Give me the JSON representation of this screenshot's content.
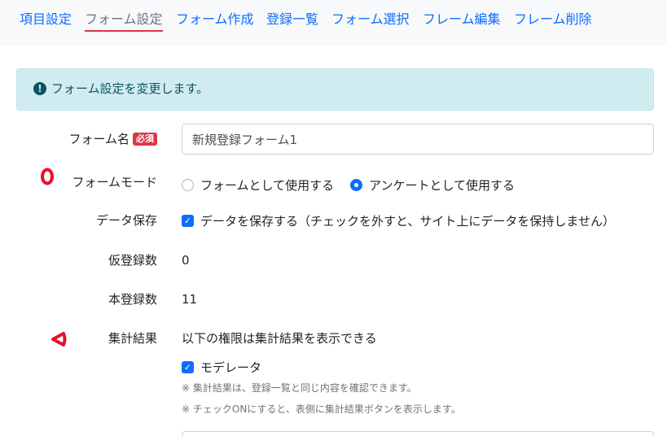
{
  "nav": {
    "tabs": [
      {
        "label": "項目設定"
      },
      {
        "label": "フォーム設定"
      },
      {
        "label": "フォーム作成"
      },
      {
        "label": "登録一覧"
      },
      {
        "label": "フォーム選択"
      },
      {
        "label": "フレーム編集"
      },
      {
        "label": "フレーム削除"
      }
    ],
    "active_tab": "フォーム設定"
  },
  "alert": {
    "icon": "exclamation-circle-icon",
    "text": "フォーム設定を変更します。"
  },
  "form": {
    "form_name": {
      "label": "フォーム名",
      "required_badge": "必須",
      "value": "新規登録フォーム1"
    },
    "form_mode": {
      "label": "フォームモード",
      "options": [
        {
          "label": "フォームとして使用する",
          "checked": false
        },
        {
          "label": "アンケートとして使用する",
          "checked": true
        }
      ]
    },
    "data_save": {
      "label": "データ保存",
      "checkbox_label": "データを保存する（チェックを外すと、サイト上にデータを保持しません）",
      "checked": true
    },
    "temp_count": {
      "label": "仮登録数",
      "value": "0"
    },
    "main_count": {
      "label": "本登録数",
      "value": "11"
    },
    "aggregate": {
      "label": "集計結果",
      "description": "以下の権限は集計結果を表示できる",
      "checkbox_label": "モデレータ",
      "checked": true,
      "note1": "※ 集計結果は、登録一覧と同じ内容を確認できます。",
      "note2": "※ チェックONにすると、表側に集計結果ボタンを表示します。"
    }
  },
  "colors": {
    "link": "#0d6efd",
    "active_tab_underline": "#dc3545",
    "alert_bg": "#d1ecf1",
    "alert_text": "#0c5460",
    "marker": "#e8112d"
  }
}
